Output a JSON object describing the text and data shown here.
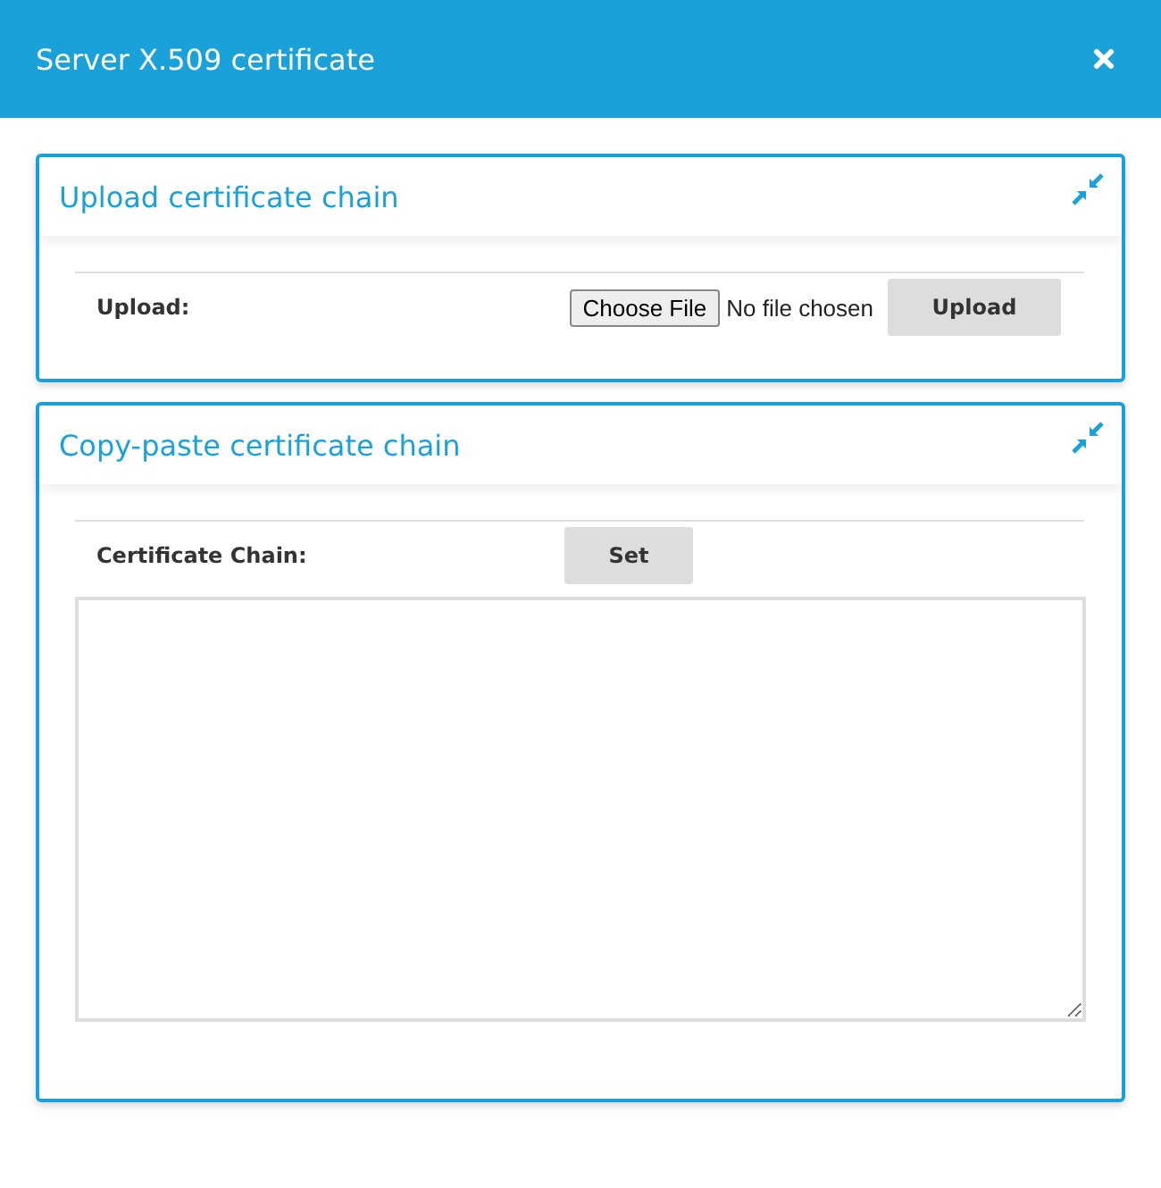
{
  "window": {
    "title": "Server X.509 certificate"
  },
  "panels": [
    {
      "kind": "upload",
      "title": "Upload certificate chain",
      "label": "Upload:",
      "file_button": "Choose File",
      "file_status": "No file chosen",
      "button": "Upload"
    },
    {
      "kind": "paste",
      "title": "Copy-paste certificate chain",
      "label": "Certificate Chain:",
      "button": "Set"
    }
  ]
}
